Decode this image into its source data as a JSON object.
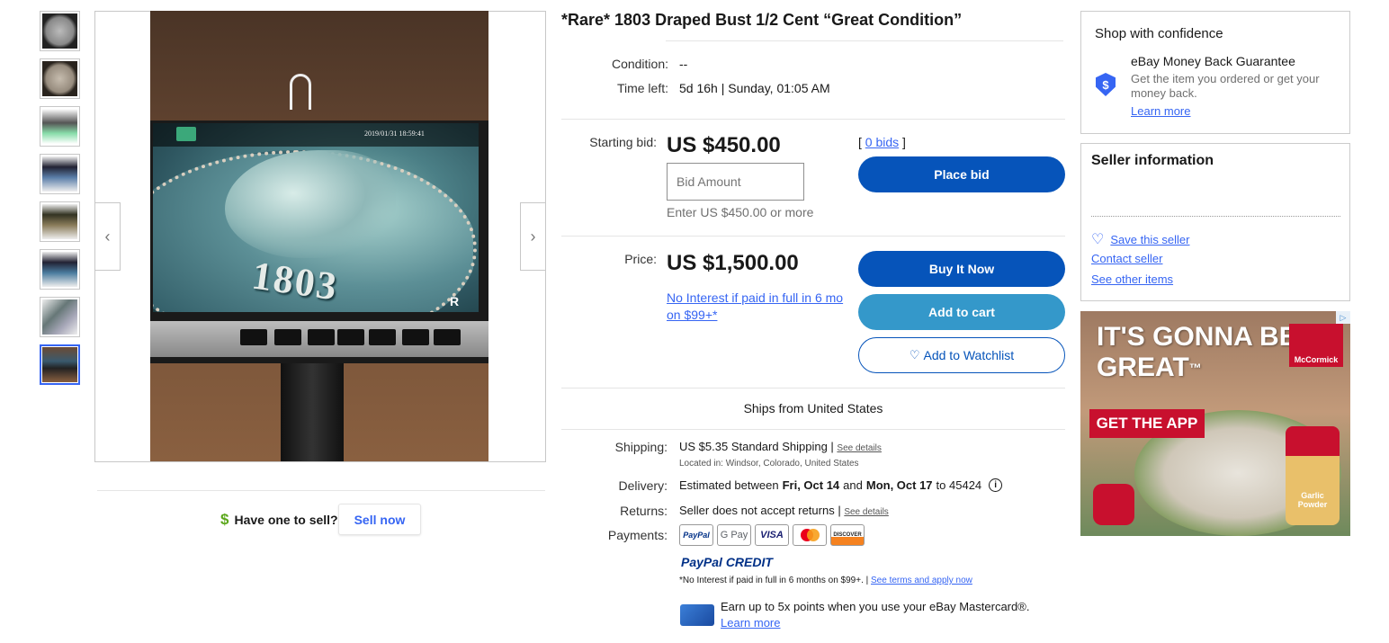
{
  "thumbnails": [
    {
      "label": "thumb-1"
    },
    {
      "label": "thumb-2"
    },
    {
      "label": "thumb-3"
    },
    {
      "label": "thumb-4"
    },
    {
      "label": "thumb-5"
    },
    {
      "label": "thumb-6"
    },
    {
      "label": "thumb-7"
    },
    {
      "label": "thumb-8"
    }
  ],
  "viewer": {
    "photo_timestamp": "2019/01/31  18:59:41",
    "coin_year": "1803",
    "prev_icon": "chevron-left-icon",
    "next_icon": "chevron-right-icon"
  },
  "sell": {
    "prompt": "Have one to sell?",
    "button": "Sell now"
  },
  "item": {
    "title": "*Rare* 1803 Draped Bust 1/2 Cent “Great Condition”",
    "condition_label": "Condition:",
    "condition_value": "--",
    "time_left_label": "Time left:",
    "time_left_value": "5d 16h | Sunday, 01:05 AM",
    "starting_bid_label": "Starting bid:",
    "starting_bid_value": "US $450.00",
    "bids_open": "[",
    "bids_link": "0 bids",
    "bids_close": "]",
    "bid_placeholder": "Bid Amount",
    "bid_hint": "Enter US $450.00 or more",
    "place_bid": "Place bid",
    "price_label": "Price:",
    "price_value": "US $1,500.00",
    "financing_link": "No Interest if paid in full in 6 mo on $99+*",
    "buy_it_now": "Buy It Now",
    "add_to_cart": "Add to cart",
    "add_to_watchlist": "Add to Watchlist",
    "ships_from": "Ships from United States",
    "shipping_label": "Shipping:",
    "shipping_cost": "US $5.35",
    "shipping_method": "Standard Shipping |",
    "see_details": "See details",
    "located_in": "Located in: Windsor, Colorado, United States",
    "delivery_label": "Delivery:",
    "delivery_prefix": "Estimated between",
    "delivery_start": "Fri, Oct 14",
    "delivery_and": "and",
    "delivery_end": "Mon, Oct 17",
    "delivery_suffix": "to 45424",
    "returns_label": "Returns:",
    "returns_value": "Seller does not accept returns |",
    "payments_label": "Payments:",
    "payment_logos": [
      "PayPal",
      "G Pay",
      "VISA",
      "",
      "DISCOVER"
    ],
    "paypal_credit": "PayPal CREDIT",
    "credit_terms": "*No Interest if paid in full in 6 months on $99+. |",
    "terms_link": "See terms and apply now",
    "mastercard_promo": "Earn up to 5x points when you use your eBay Mastercard®.",
    "learn_more": "Learn more"
  },
  "confidence": {
    "heading": "Shop with confidence",
    "guarantee_title": "eBay Money Back Guarantee",
    "guarantee_text": "Get the item you ordered or get your money back.",
    "learn_more": "Learn more"
  },
  "seller": {
    "heading": "Seller information",
    "save": "Save this seller",
    "contact": "Contact seller",
    "other_items": "See other items"
  },
  "ad": {
    "headline_1": "IT'S GONNA BE",
    "headline_2": "GREAT",
    "tm": "™",
    "cta": "GET THE APP",
    "brand": "McCormick",
    "product_1": "Garlic",
    "product_2": "Powder",
    "badge": "▷"
  },
  "colors": {
    "primary_blue": "#0654ba",
    "secondary_blue": "#3498ca",
    "link_blue": "#3665f3",
    "ad_red": "#c8102e"
  }
}
